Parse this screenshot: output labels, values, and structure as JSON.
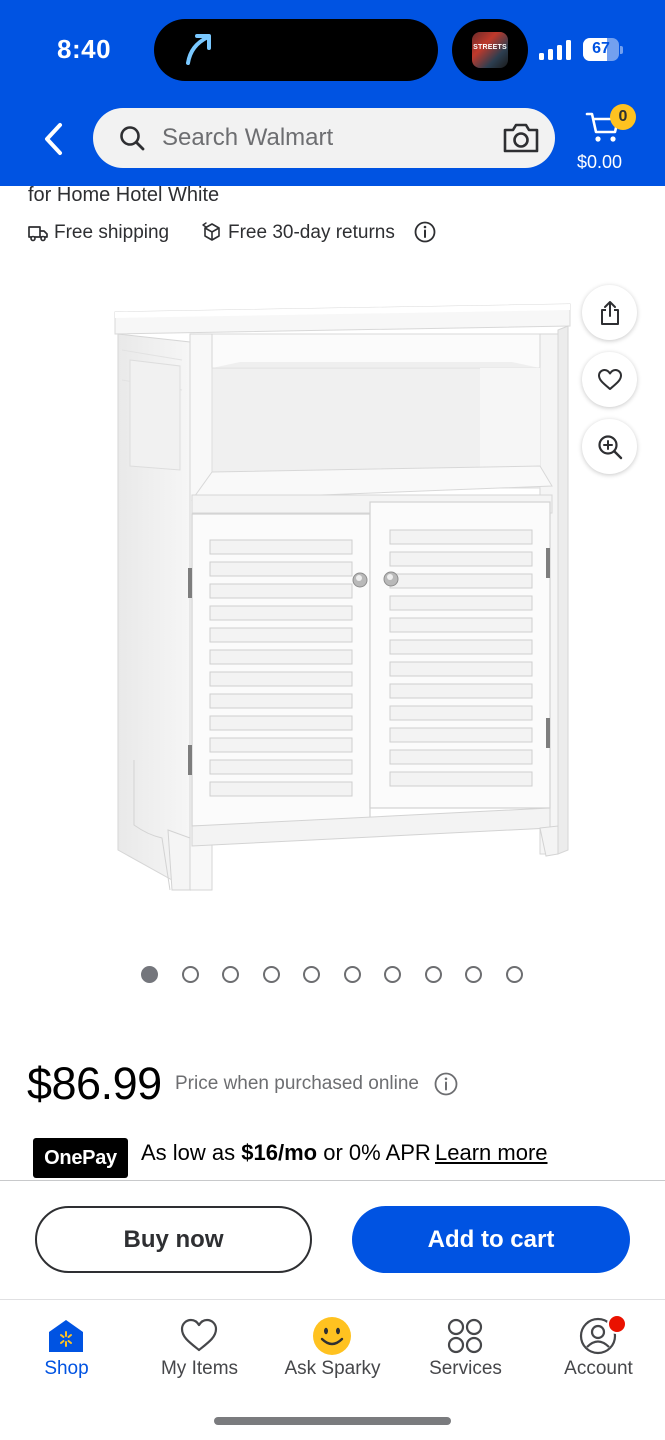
{
  "status_bar": {
    "time": "8:40",
    "battery": "67",
    "battery_level_percent": 67,
    "live_activity_label": "STREETS"
  },
  "header": {
    "search_placeholder": "Search Walmart",
    "cart_count": "0",
    "cart_total": "$0.00",
    "brand_color": "#0053e2",
    "badge_color": "#ffc220"
  },
  "product": {
    "title_tail": "for Home Hotel White",
    "free_shipping": "Free shipping",
    "free_returns": "Free 30-day returns",
    "image_count": 10,
    "active_image_index": 0,
    "price": "$86.99",
    "price_note": "Price when purchased online"
  },
  "onepay": {
    "badge": "OnePay",
    "prefix": "As low as ",
    "amount": "$16/mo",
    "suffix": " or 0% APR",
    "link": "Learn more"
  },
  "actions": {
    "buy_now": "Buy now",
    "add_to_cart": "Add to cart"
  },
  "tabs": [
    {
      "label": "Shop",
      "icon": "shop-icon",
      "active": true
    },
    {
      "label": "My Items",
      "icon": "heart-icon",
      "active": false
    },
    {
      "label": "Ask Sparky",
      "icon": "sparky-icon",
      "active": false
    },
    {
      "label": "Services",
      "icon": "services-icon",
      "active": false
    },
    {
      "label": "Account",
      "icon": "account-icon",
      "active": false
    }
  ]
}
